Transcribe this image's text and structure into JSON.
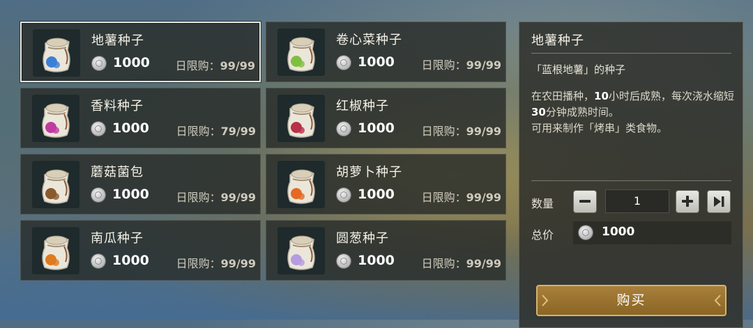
{
  "items": [
    {
      "name": "地薯种子",
      "price": "1000",
      "limit_label": "日限购：",
      "limit_value": "99/99",
      "accent": "#3c7fd6",
      "icon": "blue-potato-seed-bag-icon"
    },
    {
      "name": "卷心菜种子",
      "price": "1000",
      "limit_label": "日限购：",
      "limit_value": "99/99",
      "accent": "#7fbf3f",
      "icon": "cabbage-seed-bag-icon"
    },
    {
      "name": "香料种子",
      "price": "1000",
      "limit_label": "日限购：",
      "limit_value": "79/99",
      "accent": "#c03aa0",
      "icon": "spice-seed-bag-icon"
    },
    {
      "name": "红椒种子",
      "price": "1000",
      "limit_label": "日限购：",
      "limit_value": "99/99",
      "accent": "#b8304a",
      "icon": "red-pepper-seed-bag-icon"
    },
    {
      "name": "蘑菇菌包",
      "price": "1000",
      "limit_label": "日限购：",
      "limit_value": "99/99",
      "accent": "#8a5a2c",
      "icon": "mushroom-spawn-bag-icon"
    },
    {
      "name": "胡萝卜种子",
      "price": "1000",
      "limit_label": "日限购：",
      "limit_value": "99/99",
      "accent": "#e56a24",
      "icon": "carrot-seed-bag-icon"
    },
    {
      "name": "南瓜种子",
      "price": "1000",
      "limit_label": "日限购：",
      "limit_value": "99/99",
      "accent": "#e07a1e",
      "icon": "pumpkin-seed-bag-icon"
    },
    {
      "name": "圆葱种子",
      "price": "1000",
      "limit_label": "日限购：",
      "limit_value": "99/99",
      "accent": "#b79be0",
      "icon": "onion-seed-bag-icon"
    }
  ],
  "detail": {
    "title": "地薯种子",
    "subtitle": "「蓝根地薯」的种子",
    "desc_1": "在农田播种，",
    "desc_hours": "10",
    "desc_2": "小时后成熟，每次浇水缩短",
    "desc_minutes": "30",
    "desc_3": "分钟成熟时间。",
    "desc_4": "可用来制作「烤串」类食物。",
    "quantity_label": "数量",
    "quantity_value": "1",
    "total_label": "总价",
    "total_value": "1000",
    "buy_label": "购买"
  },
  "colors": {
    "buy_button": "#9a7430",
    "selected_border": "#e8e8e0"
  }
}
